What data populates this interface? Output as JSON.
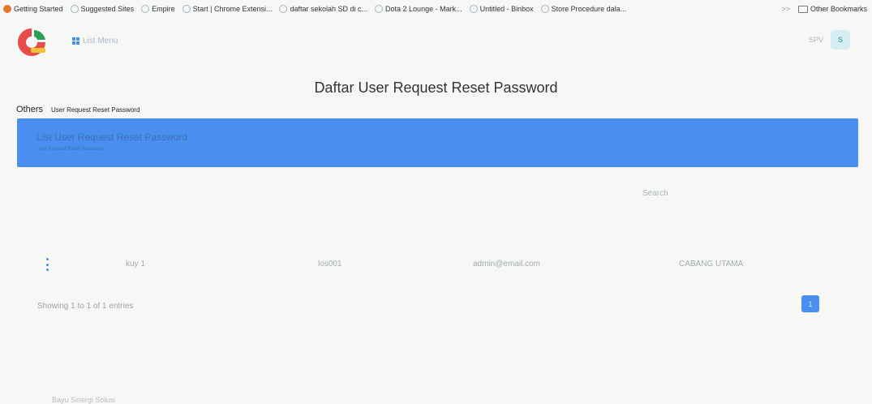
{
  "bookmarks": {
    "items": [
      "Getting Started",
      "Suggested Sites",
      "Empire",
      "Start | Chrome Extensi...",
      "daftar sekolah SD di c...",
      "Dota 2 Lounge - Mark...",
      "Untitled - Binbox",
      "Store Procedure dala..."
    ],
    "overflow": ">>",
    "other": "Other Bookmarks"
  },
  "header": {
    "list_menu": "List Menu",
    "role": "SPV",
    "avatar_initial": "S",
    "logo_colors": [
      "#e94b4b",
      "#2e9e57",
      "#f2c230"
    ]
  },
  "page": {
    "title": "Daftar User Request Reset Password",
    "breadcrumb_root": "Others",
    "breadcrumb_current": "User Request Reset Password"
  },
  "banner": {
    "title": "List User Request Reset Password",
    "subtitle": "User Request Reset Password",
    "color": "#4a8ff0"
  },
  "table": {
    "search_label": "Search",
    "rows": [
      {
        "name": "kuy 1",
        "code": "los001",
        "email": "admin@email.com",
        "branch": "CABANG UTAMA"
      }
    ],
    "entries_info": "Showing 1 to 1 of 1 entries",
    "current_page": "1"
  },
  "footer": {
    "text": "Bayu Sinergi Solusi"
  }
}
